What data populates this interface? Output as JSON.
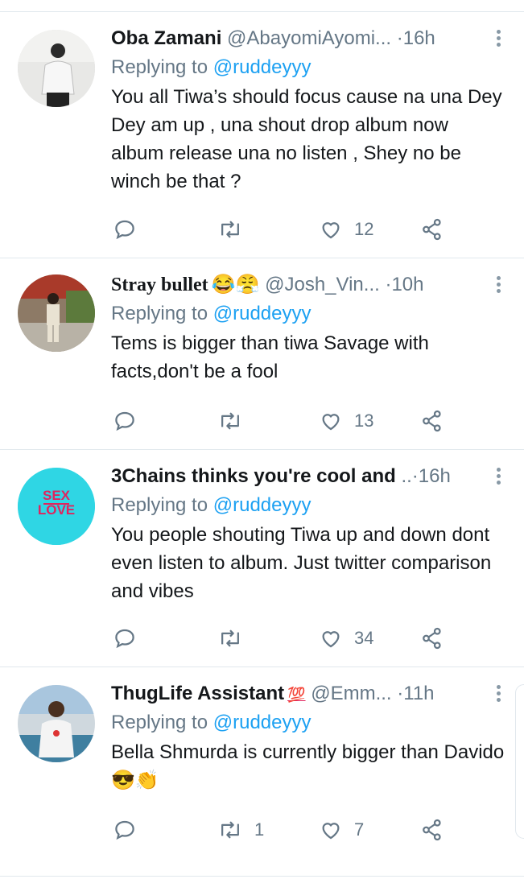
{
  "tweets": [
    {
      "name": "Oba Zamani",
      "name_emoji": "",
      "handle": "@AbayomiAyomi...",
      "time": "16h",
      "replying_prefix": "Replying to",
      "replying_handle": "@ruddeyyy",
      "body": "You all Tiwa’s should focus cause na una Dey Dey am up , una shout drop album now album release una no listen , Shey no be winch be that ?",
      "replies": "",
      "retweets": "",
      "likes": "12"
    },
    {
      "name": "Stray bullet",
      "name_emoji": "😂😤",
      "handle": "@Josh_Vin...",
      "time": "10h",
      "replying_prefix": "Replying to",
      "replying_handle": "@ruddeyyy",
      "body": "Tems is bigger than tiwa Savage with facts,don't be a fool",
      "replies": "",
      "retweets": "",
      "likes": "13"
    },
    {
      "name": "3Chains thinks you're cool and",
      "name_emoji": "",
      "handle": "",
      "ellipsis": "..",
      "time": "16h",
      "replying_prefix": "Replying to",
      "replying_handle": "@ruddeyyy",
      "body": "You people shouting Tiwa up and down dont even listen to album. Just twitter comparison and vibes",
      "replies": "",
      "retweets": "",
      "likes": "34",
      "avatar_text_top": "SEX",
      "avatar_text_bottom": "LOVE"
    },
    {
      "name": "ThugLife Assistant",
      "name_emoji": "💯",
      "handle": "@Emm...",
      "time": "11h",
      "replying_prefix": "Replying to",
      "replying_handle": "@ruddeyyy",
      "body": "Bella Shmurda is currently bigger than Davido",
      "body_emoji": "😎👏",
      "replies": "",
      "retweets": "1",
      "likes": "7"
    }
  ],
  "colors": {
    "text": "#14171a",
    "secondary": "#657786",
    "link": "#1da1f2",
    "divider": "#e1e8ed",
    "avatar3_bg": "#2fd6e4"
  },
  "icons": [
    "reply-icon",
    "retweet-icon",
    "like-icon",
    "share-icon",
    "more-icon"
  ]
}
